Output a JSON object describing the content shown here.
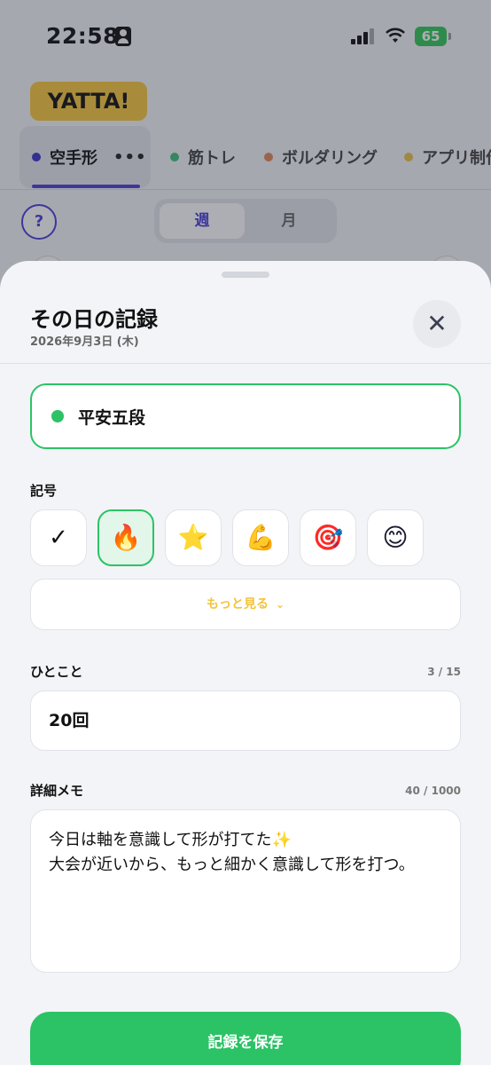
{
  "status_bar": {
    "time": "22:58",
    "battery": "65"
  },
  "app": {
    "logo": "YATTA!",
    "tabs": [
      {
        "label": "空手形",
        "color": "#3b35c9",
        "more": "•••"
      },
      {
        "label": "筋トレ",
        "color": "#3fbf7f"
      },
      {
        "label": "ボルダリング",
        "color": "#e0885a"
      },
      {
        "label": "アプリ制作",
        "color": "#e8c24a"
      }
    ],
    "help": "?",
    "period": {
      "week": "週",
      "month": "月"
    }
  },
  "sheet": {
    "title": "その日の記録",
    "date": "2026年9月3日 (木)",
    "close_icon": "✕",
    "practice": {
      "name": "平安五段",
      "color": "#2bc365"
    },
    "symbols_label": "記号",
    "symbols": [
      {
        "icon": "check-icon",
        "glyph": "✓"
      },
      {
        "icon": "fire-icon",
        "glyph": "🔥",
        "selected": true
      },
      {
        "icon": "star-icon",
        "glyph": "⭐"
      },
      {
        "icon": "muscle-icon",
        "glyph": "💪"
      },
      {
        "icon": "target-icon",
        "glyph": "🎯"
      },
      {
        "icon": "smile-icon",
        "glyph": "😊"
      }
    ],
    "more_label": "もっと見る",
    "comment_label": "ひとこと",
    "comment_counter": "3 / 15",
    "comment_value": "20回",
    "memo_label": "詳細メモ",
    "memo_counter": "40 / 1000",
    "memo_value": "今日は軸を意識して形が打てた✨\n大会が近いから、もっと細かく意識して形を打つ。",
    "save_label": "記録を保存"
  },
  "colors": {
    "accent": "#4b3fd8",
    "green": "#2bc365",
    "yellow": "#f7c93e"
  }
}
